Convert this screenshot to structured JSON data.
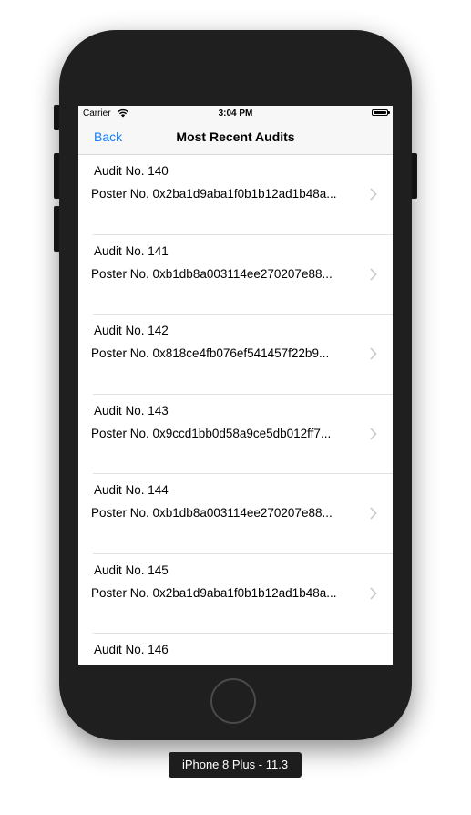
{
  "status_bar": {
    "carrier": "Carrier",
    "time": "3:04 PM",
    "wifi_icon": "wifi-icon",
    "battery_icon": "battery-icon"
  },
  "nav": {
    "back_label": "Back",
    "title": "Most Recent Audits"
  },
  "audits": [
    {
      "title": "Audit No. 140",
      "poster": "Poster No. 0x2ba1d9aba1f0b1b12ad1b48a..."
    },
    {
      "title": "Audit No. 141",
      "poster": "Poster No. 0xb1db8a003114ee270207e88..."
    },
    {
      "title": "Audit No. 142",
      "poster": "Poster No. 0x818ce4fb076ef541457f22b9..."
    },
    {
      "title": "Audit No. 143",
      "poster": "Poster No. 0x9ccd1bb0d58a9ce5db012ff7..."
    },
    {
      "title": "Audit No. 144",
      "poster": "Poster No. 0xb1db8a003114ee270207e88..."
    },
    {
      "title": "Audit No. 145",
      "poster": "Poster No. 0x2ba1d9aba1f0b1b12ad1b48a..."
    },
    {
      "title": "Audit No. 146",
      "poster": ""
    }
  ],
  "row_icon": "chevron-right-icon",
  "device_label": "iPhone 8 Plus - 11.3",
  "colors": {
    "tint": "#147efb",
    "device_frame": "#1f1f1f",
    "bar_background": "#f7f7f7",
    "chevron": "#c7c7cc"
  }
}
